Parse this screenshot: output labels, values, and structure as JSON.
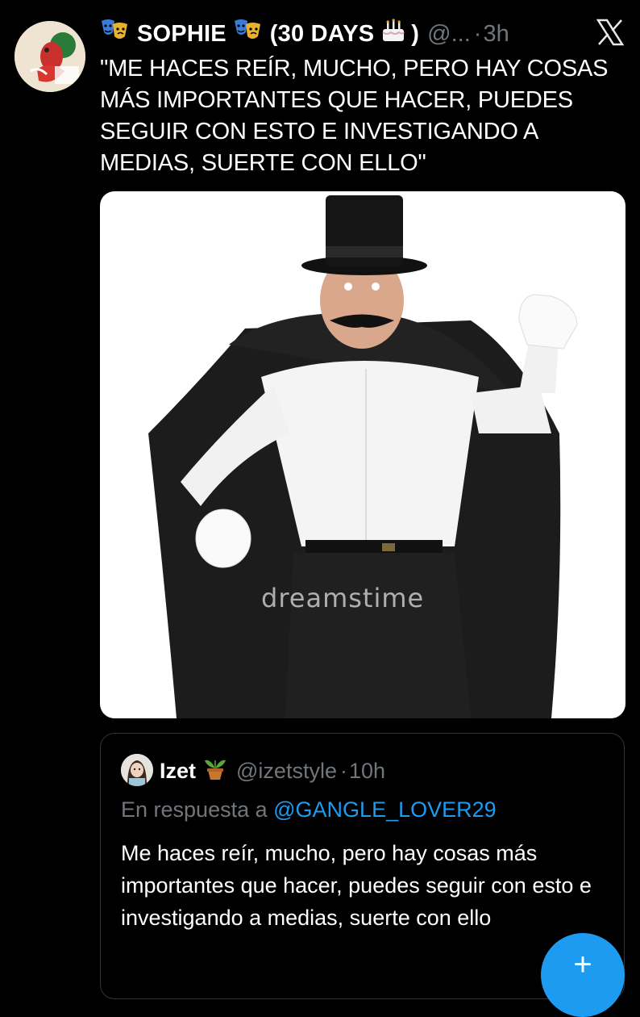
{
  "tweet": {
    "author_name": "SOPHIE",
    "author_suffix": "(30 DAYS",
    "author_close": ")",
    "handle": "@...",
    "separator": "·",
    "time": "3h",
    "text": "\"ME HACES REÍR, MUCHO, PERO HAY COSAS MÁS IMPORTANTES QUE HACER, PUEDES SEGUIR CON ESTO E INVESTIGANDO A MEDIAS, SUERTE CON ELLO\"",
    "media_watermark": "dreamstime",
    "avatar_icon": "profile-avatar-cartoon",
    "name_icons": [
      "theater-masks-icon",
      "theater-masks-icon",
      "birthday-cake-icon"
    ]
  },
  "quoted": {
    "author_name": "Izet",
    "handle": "@izetstyle",
    "separator": "·",
    "time": "10h",
    "reply_prefix": "En respuesta a",
    "reply_mention": "@GANGLE_LOVER29",
    "text": "Me haces reír, mucho, pero hay cosas más importantes que hacer, puedes seguir con esto e investigando a medias, suerte con ello",
    "name_icon": "potted-plant-icon"
  },
  "fab_label": "+",
  "colors": {
    "background": "#000000",
    "text": "#ffffff",
    "secondary": "#71767b",
    "link": "#1d9bf0",
    "border": "#2f3336"
  }
}
